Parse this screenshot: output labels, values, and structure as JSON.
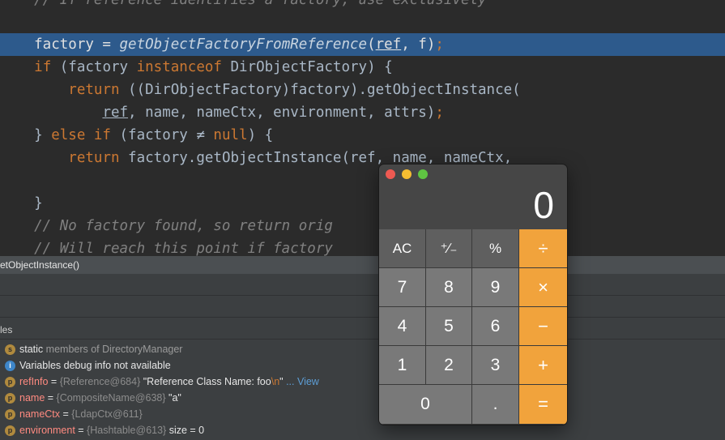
{
  "editor": {
    "lines": [
      {
        "pre": "    ",
        "comment": "// If reference identifies a factory, use exclusively"
      },
      {
        "blank": true
      },
      {
        "current": true
      },
      {
        "code": "if"
      },
      {
        "code": "return1"
      },
      {
        "code": "args1"
      },
      {
        "code": "else"
      },
      {
        "code": "return2"
      },
      {
        "blank": true
      },
      {
        "code": "close"
      },
      {
        "comment2": "// No factory found, so return orig"
      },
      {
        "comment3": "// Will reach this point if factory"
      }
    ],
    "t": {
      "l0": "    // If reference identifies a factory, use exclusively",
      "l2a": "    factory = ",
      "l2b": "getObjectFactoryFromReference",
      "l2c": "(",
      "l2d": "ref",
      "l2e": ", f)",
      "l2f": ";",
      "l3a": "    ",
      "l3b": "if",
      "l3c": " (factory ",
      "l3d": "instanceof",
      "l3e": " DirObjectFactory) {",
      "l4a": "        ",
      "l4b": "return",
      "l4c": " ((DirObjectFactory)factory).getObjectInstance(",
      "l5a": "            ",
      "l5b": "ref",
      "l5c": ", name, nameCtx, environment, attrs)",
      "l5d": ";",
      "l6a": "    } ",
      "l6b": "else if",
      "l6c": " (factory ≠ ",
      "l6d": "null",
      "l6e": ") {",
      "l7a": "        ",
      "l7b": "return",
      "l7c": " factory.getObjectInstance(ref, name, nameCtx,",
      "l9": "    }",
      "l10": "    // No factory found, so return orig",
      "l11": "    // Will reach this point if factory"
    }
  },
  "debugger": {
    "frame": "etObjectInstance()",
    "vars_header": "les",
    "vars": [
      {
        "badge": "s",
        "name": "static",
        "rest": " members of DirectoryManager",
        "type": "static"
      },
      {
        "badge": "i",
        "name": "Variables debug info not available",
        "type": "info"
      },
      {
        "badge": "p",
        "name": "refInfo",
        "eq": " = ",
        "vtype": "{Reference@684}",
        "val": " \"Reference Class Name: foo",
        "esc": "\\n",
        "val2": "\"",
        "link": " ... View"
      },
      {
        "badge": "p",
        "name": "name",
        "eq": " = ",
        "vtype": "{CompositeName@638}",
        "val": " \"a\""
      },
      {
        "badge": "p",
        "name": "nameCtx",
        "eq": " = ",
        "vtype": "{LdapCtx@611}"
      },
      {
        "badge": "p",
        "name": "environment",
        "eq": " = ",
        "vtype": "{Hashtable@613}",
        "val": "  size = 0"
      }
    ]
  },
  "calculator": {
    "display": "0",
    "keys": {
      "ac": "AC",
      "plusminus": "⁺∕₋",
      "percent": "%",
      "divide": "÷",
      "k7": "7",
      "k8": "8",
      "k9": "9",
      "multiply": "×",
      "k4": "4",
      "k5": "5",
      "k6": "6",
      "minus": "−",
      "k1": "1",
      "k2": "2",
      "k3": "3",
      "plus": "+",
      "k0": "0",
      "dot": ".",
      "equals": "="
    },
    "colors": {
      "operator": "#f1a33c",
      "function": "#5f5f5f",
      "number": "#797979"
    }
  }
}
